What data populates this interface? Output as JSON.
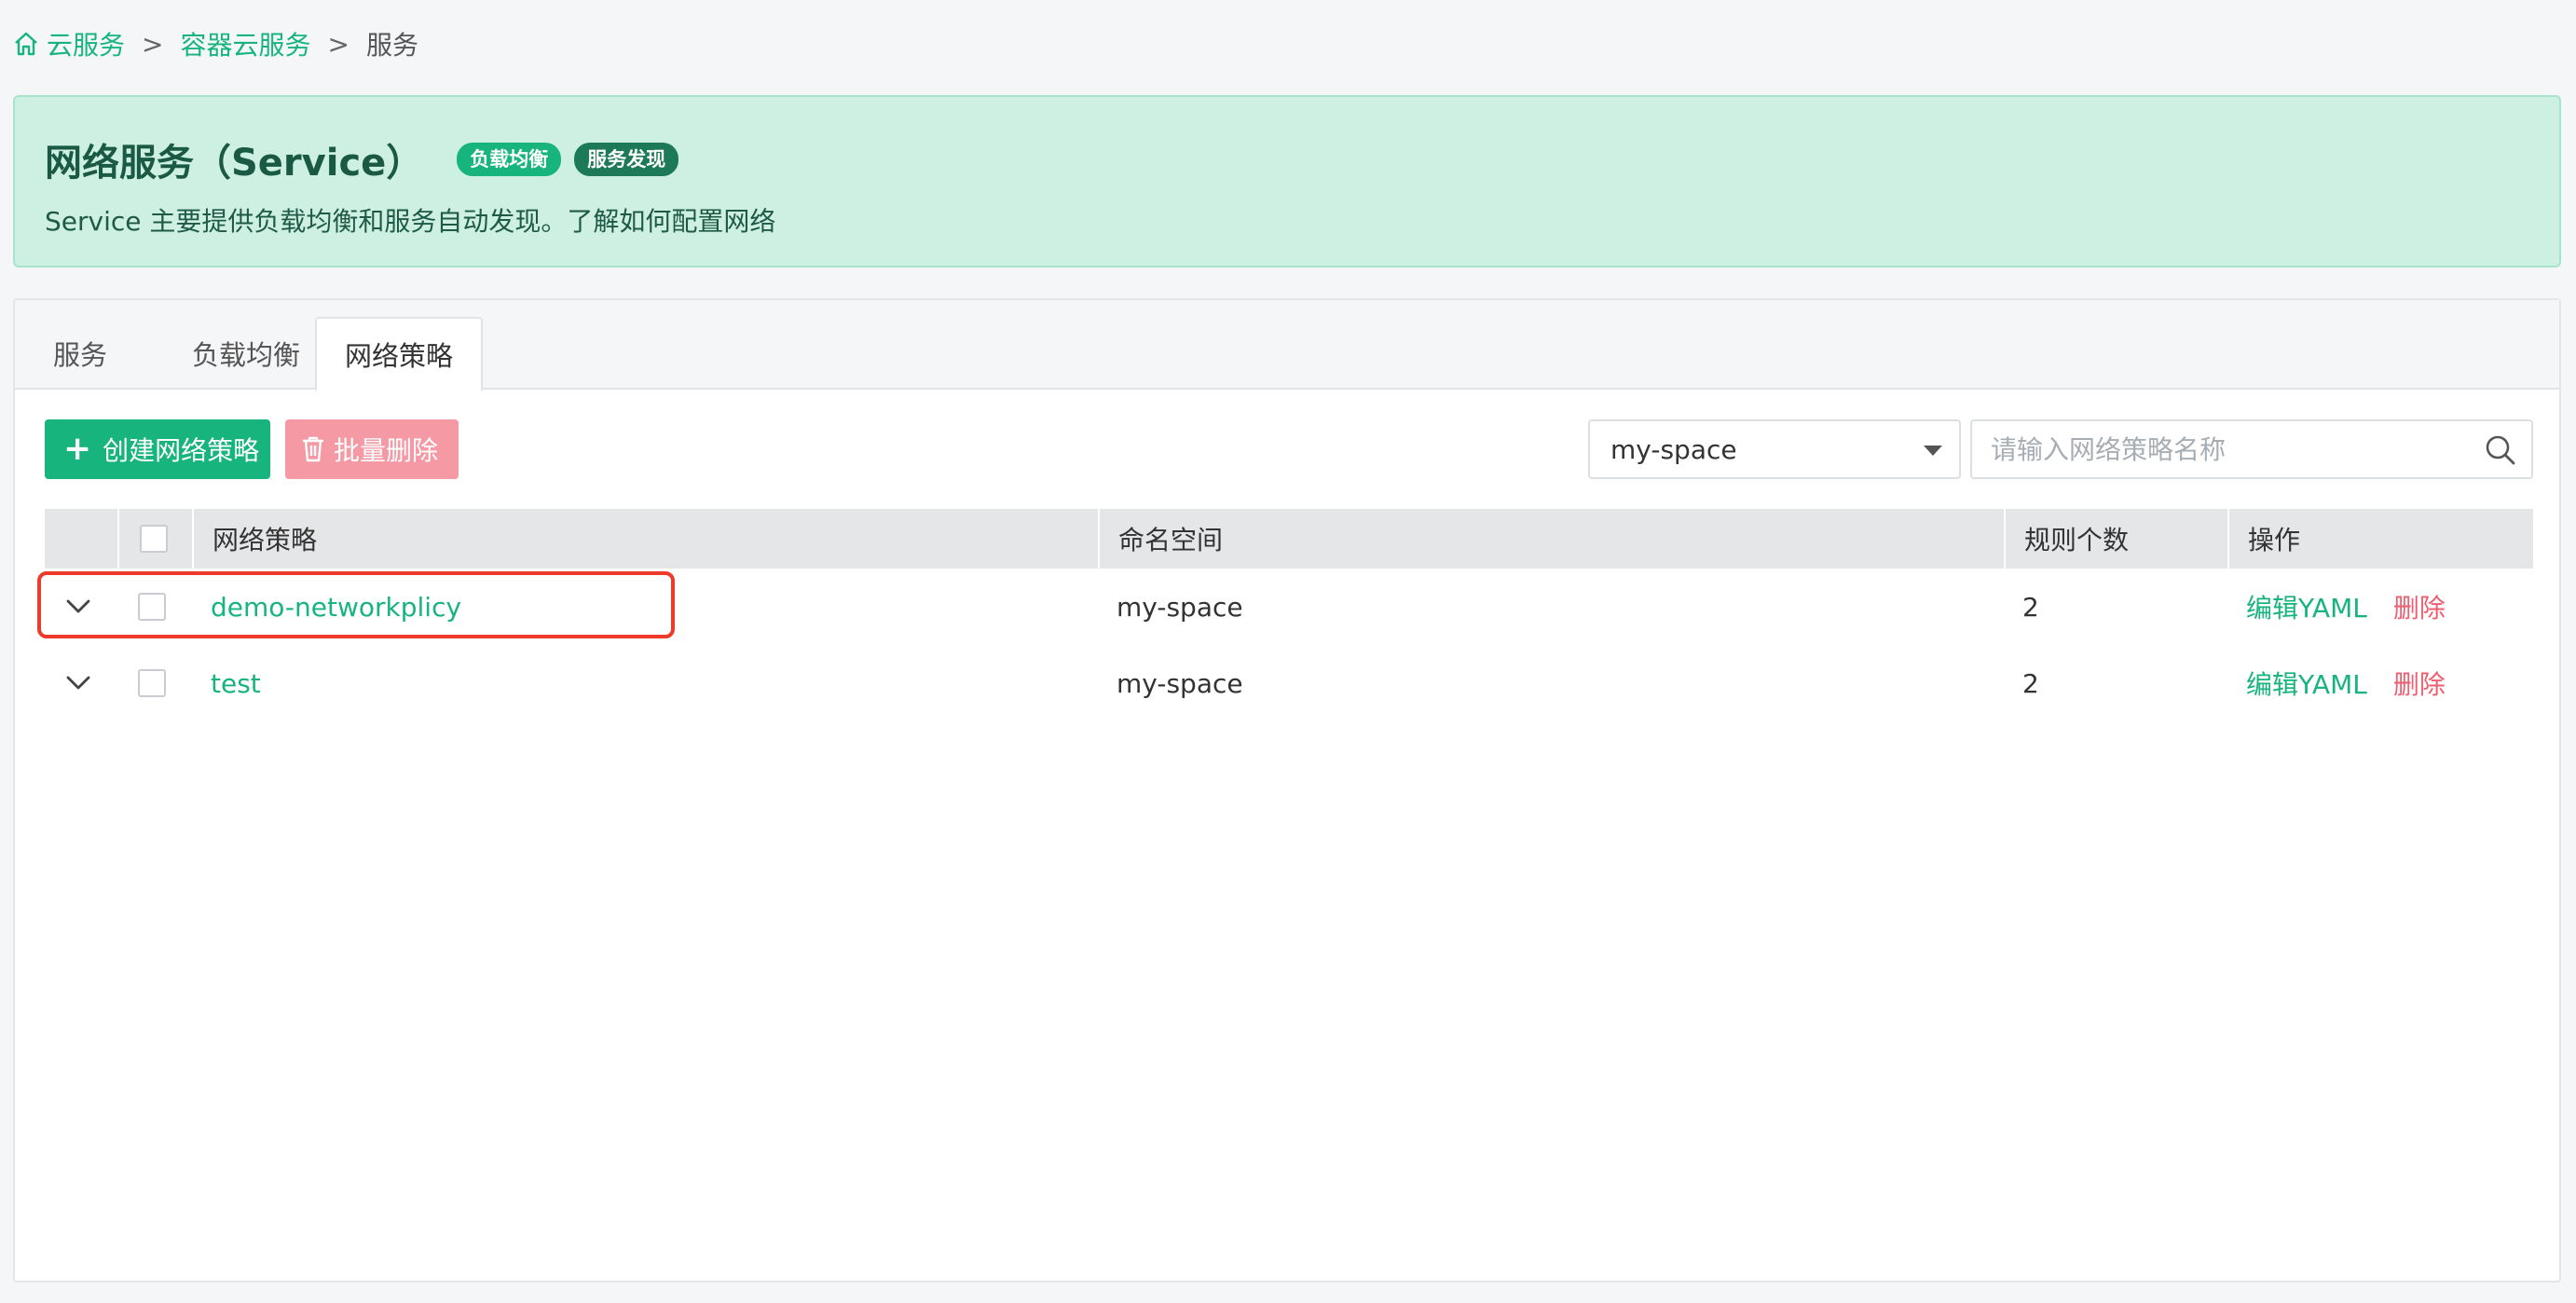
{
  "breadcrumb": {
    "items": [
      "云服务",
      "容器云服务"
    ],
    "separator": ">",
    "current": "服务"
  },
  "banner": {
    "title": "网络服务（Service）",
    "badges": [
      "负载均衡",
      "服务发现"
    ],
    "description": "Service 主要提供负载均衡和服务自动发现。了解如何配置网络"
  },
  "tabs": [
    {
      "label": "服务",
      "active": false
    },
    {
      "label": "负载均衡",
      "active": false
    },
    {
      "label": "网络策略",
      "active": true
    }
  ],
  "toolbar": {
    "create_label": "创建网络策略",
    "batch_delete_label": "批量删除",
    "namespace_selected": "my-space",
    "search_placeholder": "请输入网络策略名称"
  },
  "table": {
    "columns": [
      "网络策略",
      "命名空间",
      "规则个数",
      "操作"
    ],
    "rows": [
      {
        "name": "demo-networkplicy",
        "namespace": "my-space",
        "rules": "2",
        "edit": "编辑YAML",
        "delete": "删除"
      },
      {
        "name": "test",
        "namespace": "my-space",
        "rules": "2",
        "edit": "编辑YAML",
        "delete": "删除"
      }
    ]
  },
  "colors": {
    "accent": "#17b47e",
    "danger": "#ef5d6f",
    "banner_bg": "#cdf0e3",
    "highlight": "#ee3a2a"
  },
  "icons": [
    "home-icon",
    "plus-icon",
    "trash-icon",
    "caret-down-icon",
    "search-icon",
    "chevron-down-icon"
  ]
}
